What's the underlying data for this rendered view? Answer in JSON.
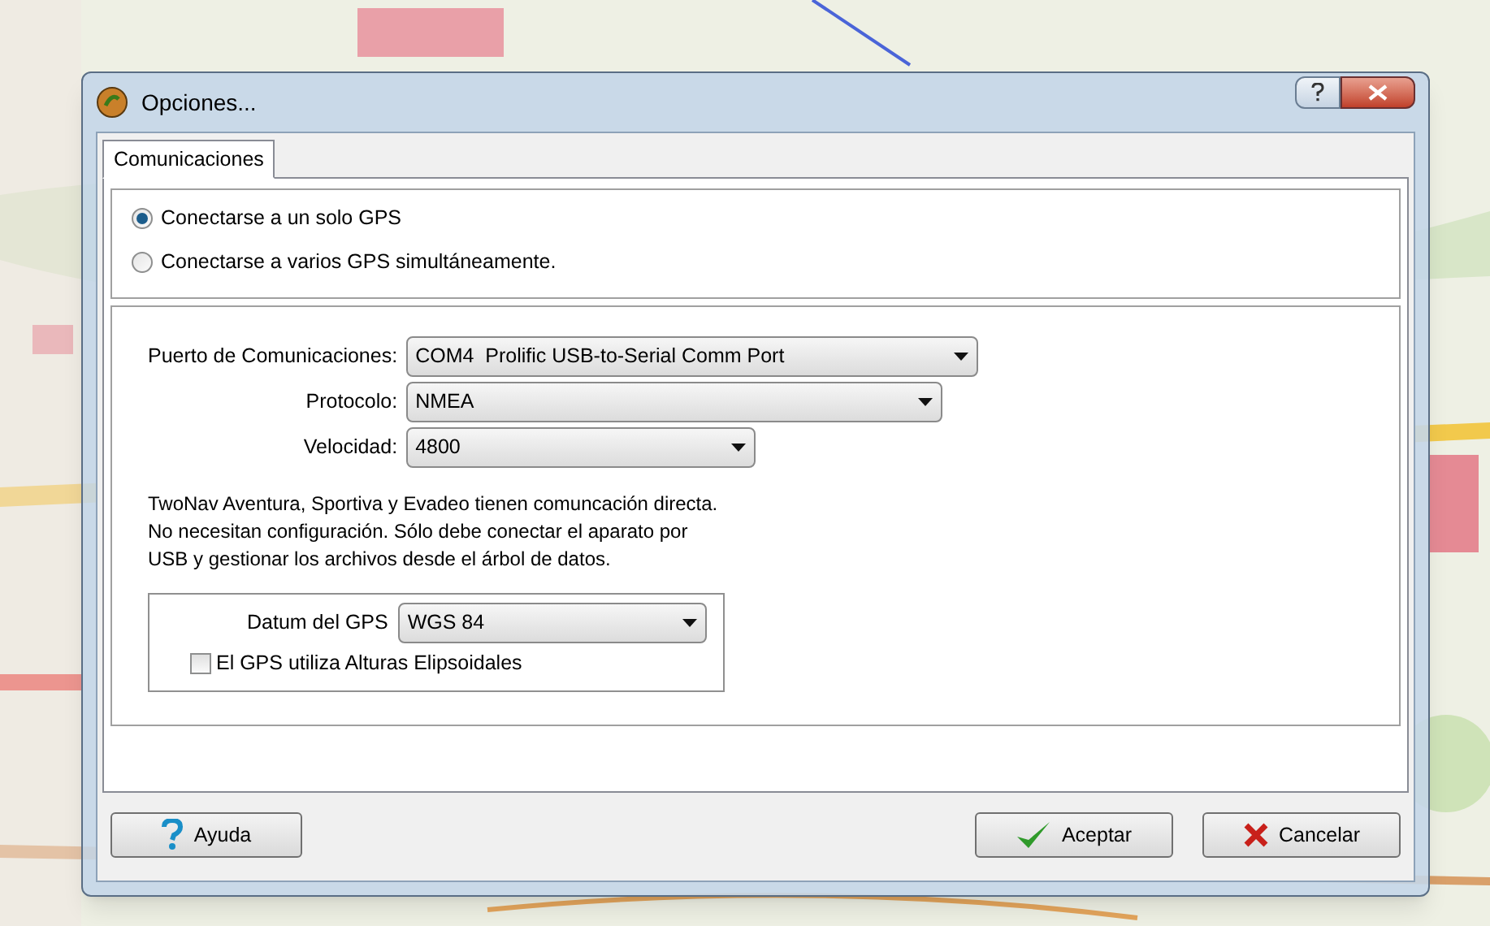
{
  "window": {
    "title": "Opciones..."
  },
  "tabs": [
    {
      "label": "Comunicaciones",
      "selected": true
    }
  ],
  "connection_mode": [
    {
      "label": "Conectarse a un solo GPS",
      "selected": true
    },
    {
      "label": "Conectarse a varios GPS simultáneamente.",
      "selected": false
    }
  ],
  "settings": [
    {
      "label": "Puerto de Comunicaciones:",
      "value": "COM4  Prolific USB-to-Serial Comm Port"
    },
    {
      "label": "Protocolo:",
      "value": "NMEA"
    },
    {
      "label": "Velocidad:",
      "value": "4800"
    }
  ],
  "info_text": "TwoNav Aventura, Sportiva y Evadeo tienen comuncación directa. No necesitan configuración. Sólo debe conectar el aparato por USB y gestionar los archivos desde el árbol de datos.",
  "datum": {
    "label": "Datum del GPS",
    "value": "WGS 84"
  },
  "ellipsoidal_heights": {
    "label": "El GPS utiliza Alturas Elipsoidales",
    "checked": false
  },
  "buttons": [
    {
      "label": "Ayuda",
      "kind": "help"
    },
    {
      "label": "Aceptar",
      "kind": "ok"
    },
    {
      "label": "Cancelar",
      "kind": "cancel"
    }
  ]
}
